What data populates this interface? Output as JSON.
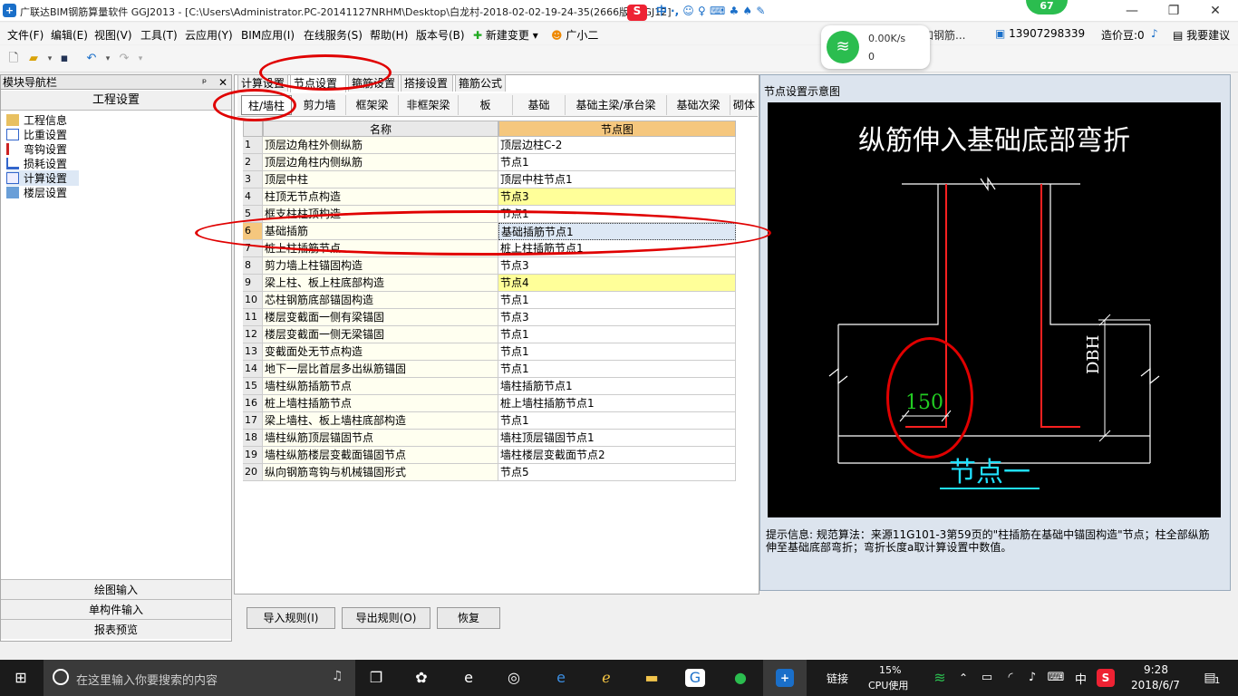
{
  "window": {
    "title": "广联达BIM钢筋算量软件 GGJ2013 - [C:\\Users\\Administrator.PC-20141127NRHM\\Desktop\\白龙村-2018-02-02-19-24-35(2666版).GGJ12]",
    "minimize": "—",
    "maximize": "❐",
    "close": "✕"
  },
  "menubar": {
    "items": [
      "文件(F)",
      "编辑(E)",
      "视图(V)",
      "工具(T)",
      "云应用(Y)",
      "BIM应用(I)",
      "在线服务(S)",
      "帮助(H)",
      "版本号(B)"
    ],
    "new_change": "新建变更",
    "assistant": "广小二",
    "phone": "13907298339",
    "price_beans": "造价豆:0",
    "suggest": "我要建议",
    "truncated_text": "加钢筋..."
  },
  "network_widget": {
    "speed": "0.00K/s",
    "count": "0",
    "badge": "67"
  },
  "nav_pane": {
    "header": "模块导航栏",
    "pin": "ᵖ",
    "close": "✕",
    "project_button": "工程设置",
    "tree": [
      "工程信息",
      "比重设置",
      "弯钩设置",
      "损耗设置",
      "计算设置",
      "楼层设置"
    ],
    "bottom_buttons": [
      "绘图输入",
      "单构件输入",
      "报表预览"
    ]
  },
  "tabs": [
    "计算设置",
    "节点设置",
    "箍筋设置",
    "搭接设置",
    "箍筋公式"
  ],
  "subtabs": [
    "柱/墙柱",
    "剪力墙",
    "框架梁",
    "非框架梁",
    "板",
    "基础",
    "基础主梁/承台梁",
    "基础次梁",
    "砌体"
  ],
  "grid": {
    "columns": [
      "名称",
      "节点图"
    ],
    "rows": [
      {
        "no": "1",
        "name": "顶层边角柱外侧纵筋",
        "node": "顶层边柱C-2"
      },
      {
        "no": "2",
        "name": "顶层边角柱内侧纵筋",
        "node": "节点1"
      },
      {
        "no": "3",
        "name": "顶层中柱",
        "node": "顶层中柱节点1"
      },
      {
        "no": "4",
        "name": "柱顶无节点构造",
        "node": "节点3"
      },
      {
        "no": "5",
        "name": "框支柱柱顶构造",
        "node": "节点1"
      },
      {
        "no": "6",
        "name": "基础插筋",
        "node": "基础插筋节点1"
      },
      {
        "no": "7",
        "name": "桩上柱插筋节点",
        "node": "桩上柱插筋节点1"
      },
      {
        "no": "8",
        "name": "剪力墙上柱锚固构造",
        "node": "节点3"
      },
      {
        "no": "9",
        "name": "梁上柱、板上柱底部构造",
        "node": "节点4"
      },
      {
        "no": "10",
        "name": "芯柱钢筋底部锚固构造",
        "node": "节点1"
      },
      {
        "no": "11",
        "name": "楼层变截面一侧有梁锚固",
        "node": "节点3"
      },
      {
        "no": "12",
        "name": "楼层变截面一侧无梁锚固",
        "node": "节点1"
      },
      {
        "no": "13",
        "name": "变截面处无节点构造",
        "node": "节点1"
      },
      {
        "no": "14",
        "name": "地下一层比首层多出纵筋锚固",
        "node": "节点1"
      },
      {
        "no": "15",
        "name": "墙柱纵筋插筋节点",
        "node": "墙柱插筋节点1"
      },
      {
        "no": "16",
        "name": "桩上墙柱插筋节点",
        "node": "桩上墙柱插筋节点1"
      },
      {
        "no": "17",
        "name": "梁上墙柱、板上墙柱底部构造",
        "node": "节点1"
      },
      {
        "no": "18",
        "name": "墙柱纵筋顶层锚固节点",
        "node": "墙柱顶层锚固节点1"
      },
      {
        "no": "19",
        "name": "墙柱纵筋楼层变截面锚固节点",
        "node": "墙柱楼层变截面节点2"
      },
      {
        "no": "20",
        "name": "纵向钢筋弯钩与机械锚固形式",
        "node": "节点5"
      }
    ]
  },
  "diagram_panel": {
    "title": "节点设置示意图",
    "heading": "纵筋伸入基础底部弯折",
    "dim_value": "150",
    "dim_label": "DBH",
    "node_label": "节点一",
    "hint_label": "提示信息:",
    "hint_text": "规范算法：来源11G101-3第59页的\"柱插筋在基础中锚固构造\"节点；柱全部纵筋伸至基础底部弯折；弯折长度a取计算设置中数值。"
  },
  "bottom_buttons": [
    "导入规则(I)",
    "导出规则(O)",
    "恢复"
  ],
  "taskbar": {
    "search_placeholder": "在这里输入你要搜索的内容",
    "link_label": "链接",
    "cpu_percent": "15%",
    "cpu_label": "CPU使用",
    "ime": "中",
    "time": "9:28",
    "date": "2018/6/7",
    "notify_count": "1"
  },
  "colors": {
    "highlight_yellow": "#ffff99",
    "name_col_bg": "#fffff0",
    "header_orange": "#f5c77e",
    "annotation_red": "#e00000",
    "diagram_red": "#ff2020",
    "diagram_green": "#22cc22",
    "diagram_cyan": "#20e0ff"
  }
}
